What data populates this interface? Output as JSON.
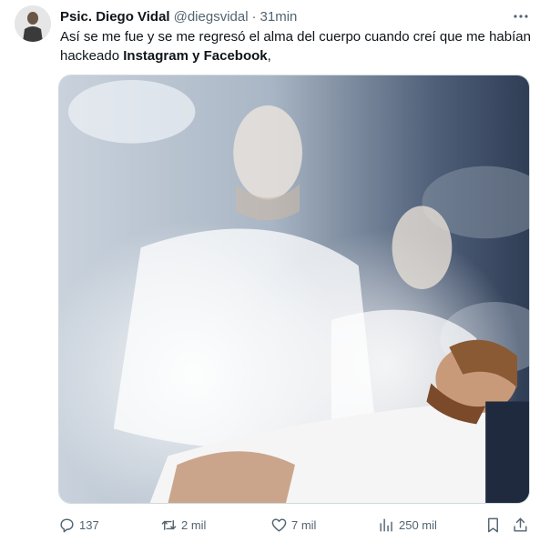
{
  "author": {
    "display_name": "Psic. Diego Vidal",
    "handle": "@diegsvidal",
    "separator": "·",
    "time": "31min"
  },
  "tweet": {
    "text_part1": "Así se me fue y se me regresó el alma del cuerpo cuando creí que me habían hackeado ",
    "text_bold": "Instagram y Facebook",
    "text_part2": ","
  },
  "actions": {
    "reply_count": "137",
    "retweet_count": "2 mil",
    "like_count": "7 mil",
    "views_count": "250 mil"
  },
  "icons": {
    "more": "more-horizontal-icon",
    "reply": "reply-icon",
    "retweet": "retweet-icon",
    "like": "heart-icon",
    "views": "views-chart-icon",
    "bookmark": "bookmark-icon",
    "share": "share-icon"
  },
  "colors": {
    "text": "#0f1419",
    "muted": "#536471",
    "border": "#cfd9de"
  }
}
